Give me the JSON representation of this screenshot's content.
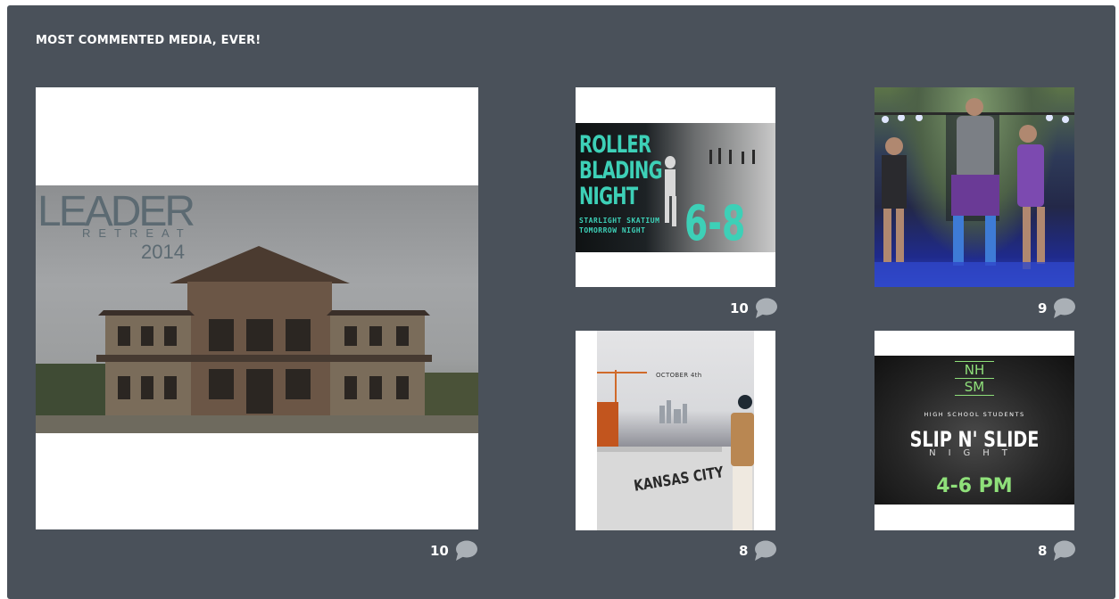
{
  "panel": {
    "title": "MOST COMMENTED MEDIA, EVER!"
  },
  "media": [
    {
      "caption": {
        "word": "LEADER",
        "sub": "RETREAT",
        "year": "2014"
      },
      "comments": "10"
    },
    {
      "caption": {
        "line1": "ROLLER",
        "line2": "BLADING",
        "line3": "NIGHT",
        "small1": "STARLIGHT SKATIUM",
        "small2": "TOMORROW NIGHT",
        "time": "6-8"
      },
      "comments": "10"
    },
    {
      "caption": {},
      "comments": "9"
    },
    {
      "caption": {
        "date": "OCTOBER 4th",
        "name": "KANSAS CITY"
      },
      "comments": "8"
    },
    {
      "caption": {
        "logo_top": "NH",
        "logo_bottom": "SM",
        "sub": "HIGH SCHOOL STUDENTS",
        "title": "SLIP N' SLIDE",
        "night": "NIGHT",
        "time": "4-6 PM"
      },
      "comments": "8"
    }
  ],
  "icons": {
    "comment": "speech-bubble-icon"
  },
  "colors": {
    "panel_bg": "#4a515a",
    "accent_teal": "#3dd0b7",
    "accent_green": "#8fe07a",
    "icon_gray": "#aab0b6"
  }
}
